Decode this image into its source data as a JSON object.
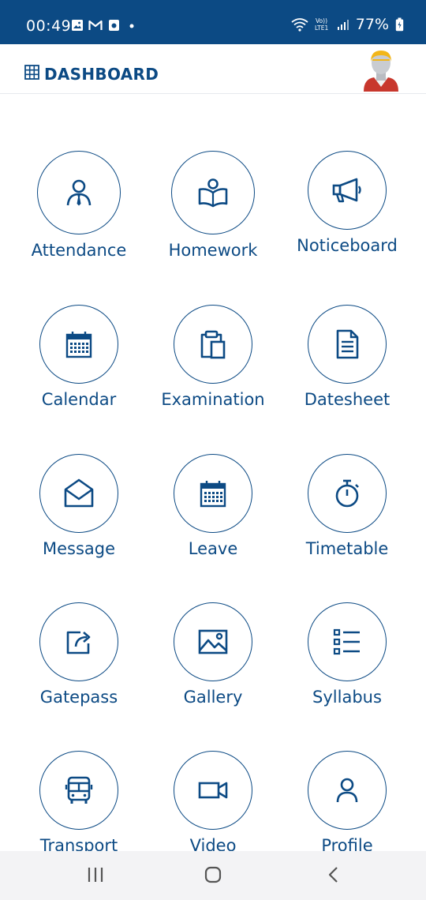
{
  "status_bar": {
    "time": "00:49",
    "battery": "77%",
    "icons": [
      "image-icon",
      "gmail-icon",
      "photo-app-icon",
      "dot-icon",
      "wifi-icon",
      "volte-icon",
      "signal-icon",
      "battery-icon"
    ]
  },
  "header": {
    "title": "DASHBOARD",
    "icon": "grid-icon",
    "avatar": "user-avatar"
  },
  "tiles": [
    {
      "label": "Attendance",
      "icon": "person-tie-icon"
    },
    {
      "label": "Homework",
      "icon": "reading-book-icon"
    },
    {
      "label": "Noticeboard",
      "icon": "megaphone-icon"
    },
    {
      "label": "Calendar",
      "icon": "calendar-icon"
    },
    {
      "label": "Examination",
      "icon": "clipboard-icon"
    },
    {
      "label": "Datesheet",
      "icon": "document-icon"
    },
    {
      "label": "Message",
      "icon": "envelope-icon"
    },
    {
      "label": "Leave",
      "icon": "calendar-icon"
    },
    {
      "label": "Timetable",
      "icon": "stopwatch-icon"
    },
    {
      "label": "Gatepass",
      "icon": "share-out-icon"
    },
    {
      "label": "Gallery",
      "icon": "image-icon"
    },
    {
      "label": "Syllabus",
      "icon": "list-icon"
    },
    {
      "label": "Transport",
      "icon": "bus-icon"
    },
    {
      "label": "Video",
      "icon": "video-camera-icon"
    },
    {
      "label": "Profile",
      "icon": "person-icon"
    }
  ],
  "nav_bar": [
    "recent-apps-icon",
    "home-icon",
    "back-icon"
  ],
  "colors": {
    "primary": "#0c4a84",
    "background": "#ffffff",
    "nav_background": "#f3f3f5"
  }
}
